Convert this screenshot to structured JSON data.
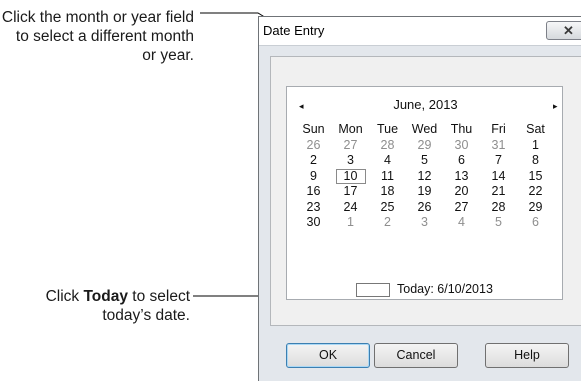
{
  "callouts": {
    "month_year": "Click the month or year field to select a different month or year.",
    "today_pre": "Click ",
    "today_bold": "Today",
    "today_post": " to select today’s date."
  },
  "dialog": {
    "title": "Date Entry",
    "close_glyph": "✕",
    "month_label": "June, 2013",
    "prev_glyph": "◂",
    "next_glyph": "▸",
    "weekdays": [
      "Sun",
      "Mon",
      "Tue",
      "Wed",
      "Thu",
      "Fri",
      "Sat"
    ],
    "weeks": [
      [
        "26",
        "27",
        "28",
        "29",
        "30",
        "31",
        "1"
      ],
      [
        "2",
        "3",
        "4",
        "5",
        "6",
        "7",
        "8"
      ],
      [
        "9",
        "10",
        "11",
        "12",
        "13",
        "14",
        "15"
      ],
      [
        "16",
        "17",
        "18",
        "19",
        "20",
        "21",
        "22"
      ],
      [
        "23",
        "24",
        "25",
        "26",
        "27",
        "28",
        "29"
      ],
      [
        "30",
        "1",
        "2",
        "3",
        "4",
        "5",
        "6"
      ]
    ],
    "today_label": "Today: 6/10/2013",
    "buttons": {
      "ok": "OK",
      "cancel": "Cancel",
      "help": "Help"
    }
  }
}
